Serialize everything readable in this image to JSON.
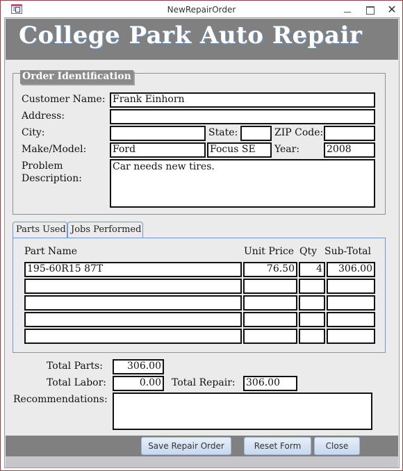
{
  "window": {
    "title": "NewRepairOrder",
    "controls": {
      "minimize": "—",
      "maximize": "☐",
      "close": "✕"
    }
  },
  "header": {
    "title": "College Park Auto Repair"
  },
  "order_identification": {
    "legend": "Order Identification",
    "customer_name": {
      "label": "Customer Name:",
      "value": "Frank Einhorn"
    },
    "address": {
      "label": "Address:",
      "value": ""
    },
    "city": {
      "label": "City:",
      "value": ""
    },
    "state": {
      "label": "State:",
      "value": ""
    },
    "zip": {
      "label": "ZIP Code:",
      "value": ""
    },
    "make_model": {
      "label": "Make/Model:",
      "make": "Ford",
      "model": "Focus SE"
    },
    "year": {
      "label": "Year:",
      "value": "2008"
    },
    "problem": {
      "label_line1": "Problem",
      "label_line2": "Description:",
      "value": "Car needs new tires."
    }
  },
  "tabs": [
    {
      "label": "Parts Used",
      "active": true
    },
    {
      "label": "Jobs Performed",
      "active": false
    }
  ],
  "parts_table": {
    "columns": [
      "Part Name",
      "Unit Price",
      "Qty",
      "Sub-Total"
    ],
    "rows": [
      {
        "part_name": "195-60R15 87T",
        "unit_price": "76.50",
        "qty": "4",
        "sub_total": "306.00"
      },
      {
        "part_name": "",
        "unit_price": "",
        "qty": "",
        "sub_total": ""
      },
      {
        "part_name": "",
        "unit_price": "",
        "qty": "",
        "sub_total": ""
      },
      {
        "part_name": "",
        "unit_price": "",
        "qty": "",
        "sub_total": ""
      },
      {
        "part_name": "",
        "unit_price": "",
        "qty": "",
        "sub_total": ""
      }
    ]
  },
  "totals": {
    "total_parts": {
      "label": "Total Parts:",
      "value": "306.00"
    },
    "total_labor": {
      "label": "Total Labor:",
      "value": "0.00"
    },
    "total_repair": {
      "label": "Total Repair:",
      "value": "306.00"
    },
    "recommendations": {
      "label": "Recommendations:",
      "value": ""
    }
  },
  "buttons": {
    "save": "Save Repair Order",
    "reset": "Reset Form",
    "close": "Close"
  }
}
